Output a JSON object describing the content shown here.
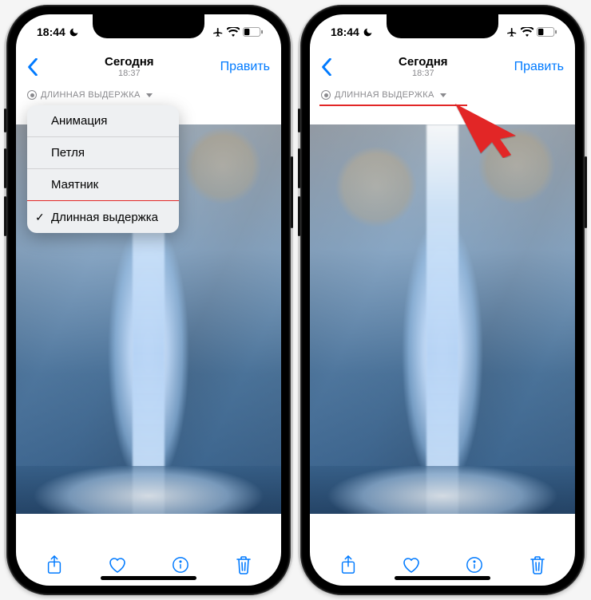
{
  "status": {
    "time": "18:44"
  },
  "nav": {
    "title": "Сегодня",
    "subtitle": "18:37",
    "edit": "Править"
  },
  "effect": {
    "label": "ДЛИННАЯ ВЫДЕРЖКА"
  },
  "menu": {
    "items": [
      {
        "label": "Анимация"
      },
      {
        "label": "Петля"
      },
      {
        "label": "Маятник"
      },
      {
        "label": "Длинная выдержка"
      }
    ]
  },
  "accent": "#007aff"
}
